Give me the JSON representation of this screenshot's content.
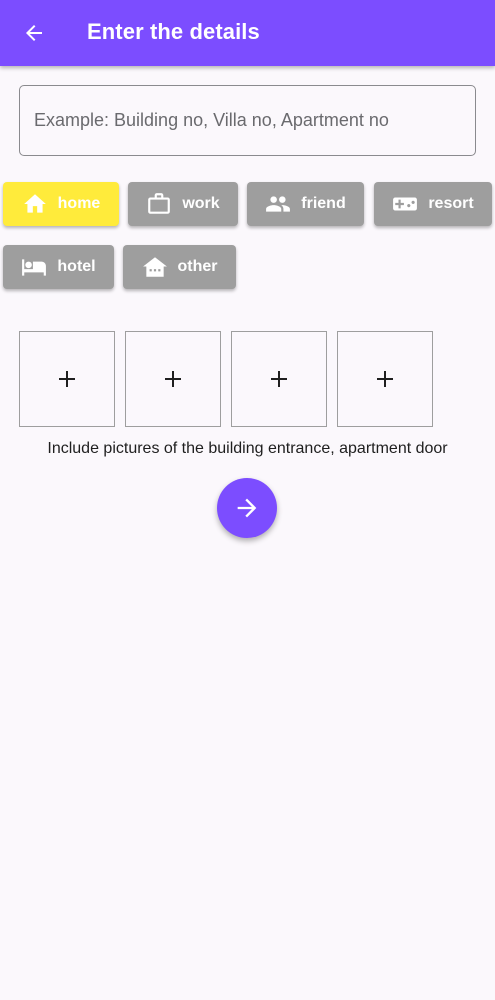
{
  "appbar": {
    "title": "Enter the details",
    "back_icon": "arrow-left-icon",
    "color": "#7c4dff"
  },
  "address_field": {
    "value": "",
    "placeholder": "Example: Building no, Villa no, Apartment no"
  },
  "categories": {
    "selected": "home",
    "selected_color": "#ffeb3b",
    "unselected_color": "#9e9e9e",
    "items": [
      {
        "label": "home",
        "icon": "home-icon"
      },
      {
        "label": "work",
        "icon": "briefcase-icon"
      },
      {
        "label": "friend",
        "icon": "people-icon"
      },
      {
        "label": "resort",
        "icon": "gamepad-icon"
      },
      {
        "label": "hotel",
        "icon": "bed-icon"
      },
      {
        "label": "other",
        "icon": "house-icon"
      }
    ]
  },
  "photos": {
    "slots": [
      "+",
      "+",
      "+",
      "+"
    ],
    "hint": "Include pictures of the building entrance, apartment door"
  },
  "next_button": {
    "icon": "arrow-right-icon"
  }
}
